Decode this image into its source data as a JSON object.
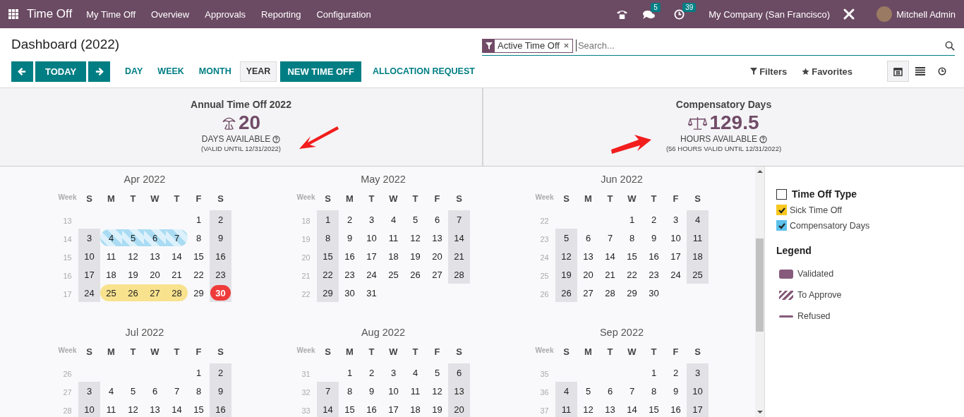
{
  "navbar": {
    "app_name": "Time Off",
    "menu": [
      "My Time Off",
      "Overview",
      "Approvals",
      "Reporting",
      "Configuration"
    ],
    "messages_count": "5",
    "activities_count": "39",
    "company": "My Company (San Francisco)",
    "user": "Mitchell Admin"
  },
  "control_panel": {
    "title": "Dashboard (2022)",
    "search": {
      "facets": [
        "Active Time Off"
      ],
      "placeholder": "Search..."
    },
    "today_label": "TODAY",
    "scales": [
      {
        "label": "DAY",
        "selected": false
      },
      {
        "label": "WEEK",
        "selected": false
      },
      {
        "label": "MONTH",
        "selected": false
      },
      {
        "label": "YEAR",
        "selected": true
      }
    ],
    "actions": [
      {
        "label": "NEW TIME OFF",
        "kind": "primary"
      },
      {
        "label": "ALLOCATION REQUEST",
        "kind": "link"
      }
    ],
    "filters_label": "Filters",
    "favorites_label": "Favorites",
    "views": [
      {
        "kind": "calendar",
        "selected": true
      },
      {
        "kind": "list",
        "selected": false
      },
      {
        "kind": "activity",
        "selected": false
      }
    ]
  },
  "summary": [
    {
      "kind": "umbrella",
      "title": "Annual Time Off 2022",
      "value": "20",
      "unit": "DAYS AVAILABLE",
      "validity": "(VALID UNTIL 12/31/2022)"
    },
    {
      "kind": "scales",
      "title": "Compensatory Days",
      "value": "129.5",
      "unit": "HOURS AVAILABLE",
      "validity": "(56 HOURS VALID UNTIL 12/31/2022)"
    }
  ],
  "calendar": {
    "months": [
      {
        "title": "Apr 2022",
        "week_label": "Week",
        "weekdays": [
          "S",
          "M",
          "T",
          "W",
          "T",
          "F",
          "S"
        ],
        "weeks": [
          {
            "week": "13",
            "days": [
              "1",
              "2"
            ]
          },
          {
            "week": "14",
            "days": [
              "3",
              {
                "day": "4",
                "kind": "to_approve",
                "color": "#a9dcf3"
              },
              {
                "day": "5",
                "kind": "to_approve",
                "color": "#a9dcf3"
              },
              {
                "day": "6",
                "kind": "to_approve",
                "color": "#a9dcf3"
              },
              {
                "day": "7",
                "kind": "to_approve",
                "color": "#a9dcf3"
              },
              "8",
              "9"
            ]
          },
          {
            "week": "15",
            "days": [
              "10",
              "11",
              "12",
              "13",
              "14",
              "15",
              "16"
            ]
          },
          {
            "week": "16",
            "days": [
              "17",
              "18",
              "19",
              "20",
              "21",
              "22",
              "23"
            ]
          },
          {
            "week": "17",
            "days": [
              "24",
              {
                "day": "25",
                "kind": "validated",
                "color": "#f8e28e"
              },
              {
                "day": "26",
                "kind": "validated",
                "color": "#f8e28e"
              },
              {
                "day": "27",
                "kind": "validated",
                "color": "#f8e28e"
              },
              {
                "day": "28",
                "kind": "validated",
                "color": "#f8e28e"
              },
              "29",
              {
                "day": "30",
                "today": true
              }
            ]
          }
        ]
      },
      {
        "title": "May 2022",
        "week_label": "Week",
        "weekdays": [
          "S",
          "M",
          "T",
          "W",
          "T",
          "F",
          "S"
        ],
        "weeks": [
          {
            "week": "18",
            "days": [
              "1",
              "2",
              "3",
              "4",
              "5",
              "6",
              "7"
            ]
          },
          {
            "week": "19",
            "days": [
              "8",
              "9",
              "10",
              "11",
              "12",
              "13",
              "14"
            ]
          },
          {
            "week": "20",
            "days": [
              "15",
              "16",
              "17",
              "18",
              "19",
              "20",
              "21"
            ]
          },
          {
            "week": "21",
            "days": [
              "22",
              "23",
              "24",
              "25",
              "26",
              "27",
              "28"
            ]
          },
          {
            "week": "22",
            "days": [
              "29",
              "30",
              "31"
            ]
          }
        ]
      },
      {
        "title": "Jun 2022",
        "week_label": "Week",
        "weekdays": [
          "S",
          "M",
          "T",
          "W",
          "T",
          "F",
          "S"
        ],
        "weeks": [
          {
            "week": "22",
            "days": [
              "1",
              "2",
              "3",
              "4"
            ]
          },
          {
            "week": "23",
            "days": [
              "5",
              "6",
              "7",
              "8",
              "9",
              "10",
              "11"
            ]
          },
          {
            "week": "24",
            "days": [
              "12",
              "13",
              "14",
              "15",
              "16",
              "17",
              "18"
            ]
          },
          {
            "week": "25",
            "days": [
              "19",
              "20",
              "21",
              "22",
              "23",
              "24",
              "25"
            ]
          },
          {
            "week": "26",
            "days": [
              "26",
              "27",
              "28",
              "29",
              "30"
            ]
          }
        ]
      },
      {
        "title": "Jul 2022",
        "week_label": "Week",
        "weekdays": [
          "S",
          "M",
          "T",
          "W",
          "T",
          "F",
          "S"
        ],
        "weeks": [
          {
            "week": "26",
            "days": [
              "1",
              "2"
            ]
          },
          {
            "week": "27",
            "days": [
              "3",
              "4",
              "5",
              "6",
              "7",
              "8",
              "9"
            ]
          },
          {
            "week": "28",
            "days": [
              "10",
              "11",
              "12",
              "13",
              "14",
              "15",
              "16"
            ]
          }
        ]
      },
      {
        "title": "Aug 2022",
        "week_label": "Week",
        "weekdays": [
          "S",
          "M",
          "T",
          "W",
          "T",
          "F",
          "S"
        ],
        "weeks": [
          {
            "week": "31",
            "days": [
              "1",
              "2",
              "3",
              "4",
              "5",
              "6"
            ]
          },
          {
            "week": "32",
            "days": [
              "7",
              "8",
              "9",
              "10",
              "11",
              "12",
              "13"
            ]
          },
          {
            "week": "33",
            "days": [
              "14",
              "15",
              "16",
              "17",
              "18",
              "19",
              "20"
            ]
          }
        ]
      },
      {
        "title": "Sep 2022",
        "week_label": "Week",
        "weekdays": [
          "S",
          "M",
          "T",
          "W",
          "T",
          "F",
          "S"
        ],
        "weeks": [
          {
            "week": "35",
            "days": [
              "1",
              "2",
              "3"
            ]
          },
          {
            "week": "36",
            "days": [
              "4",
              "5",
              "6",
              "7",
              "8",
              "9",
              "10"
            ]
          },
          {
            "week": "37",
            "days": [
              "11",
              "12",
              "13",
              "14",
              "15",
              "16",
              "17"
            ]
          }
        ]
      }
    ]
  },
  "sidebar": {
    "filter_title": "Time Off Type",
    "filter_all_checked": false,
    "filters": [
      {
        "label": "Sick Time Off",
        "checked": true,
        "color": "#f7c81e"
      },
      {
        "label": "Compensatory Days",
        "checked": true,
        "color": "#5cc1ec"
      }
    ],
    "legend_title": "Legend",
    "legend": [
      {
        "kind": "validated",
        "label": "Validated"
      },
      {
        "kind": "to_approve",
        "label": "To Approve"
      },
      {
        "kind": "refused",
        "label": "Refused"
      }
    ]
  }
}
